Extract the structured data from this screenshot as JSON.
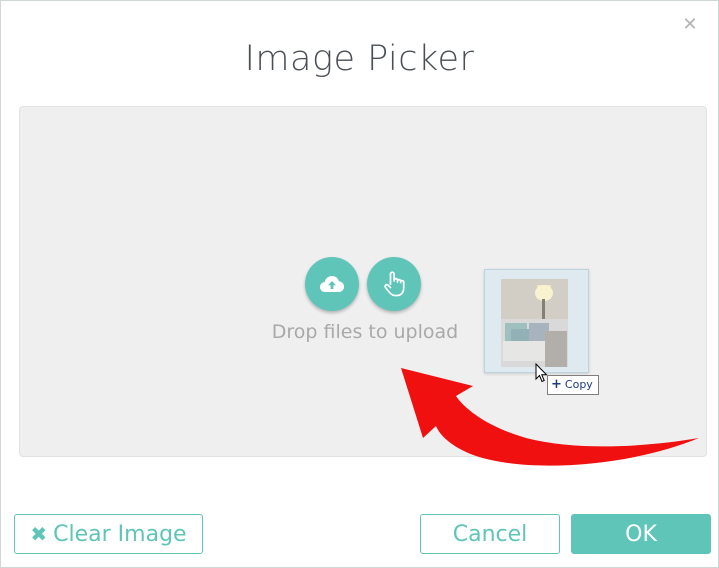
{
  "dialog": {
    "title": "Image Picker",
    "close_icon": "close-icon"
  },
  "dropzone": {
    "text": "Drop files to upload",
    "upload_icon": "cloud-upload-icon",
    "pick_icon": "hand-pointer-icon"
  },
  "drag": {
    "tooltip_label": "Copy",
    "tooltip_icon": "plus-icon"
  },
  "buttons": {
    "clear_label": "Clear Image",
    "clear_icon": "x-icon",
    "cancel_label": "Cancel",
    "ok_label": "OK"
  },
  "colors": {
    "accent": "#5fc5b8",
    "arrow": "#f01010",
    "dropzone_bg": "#efefef"
  }
}
